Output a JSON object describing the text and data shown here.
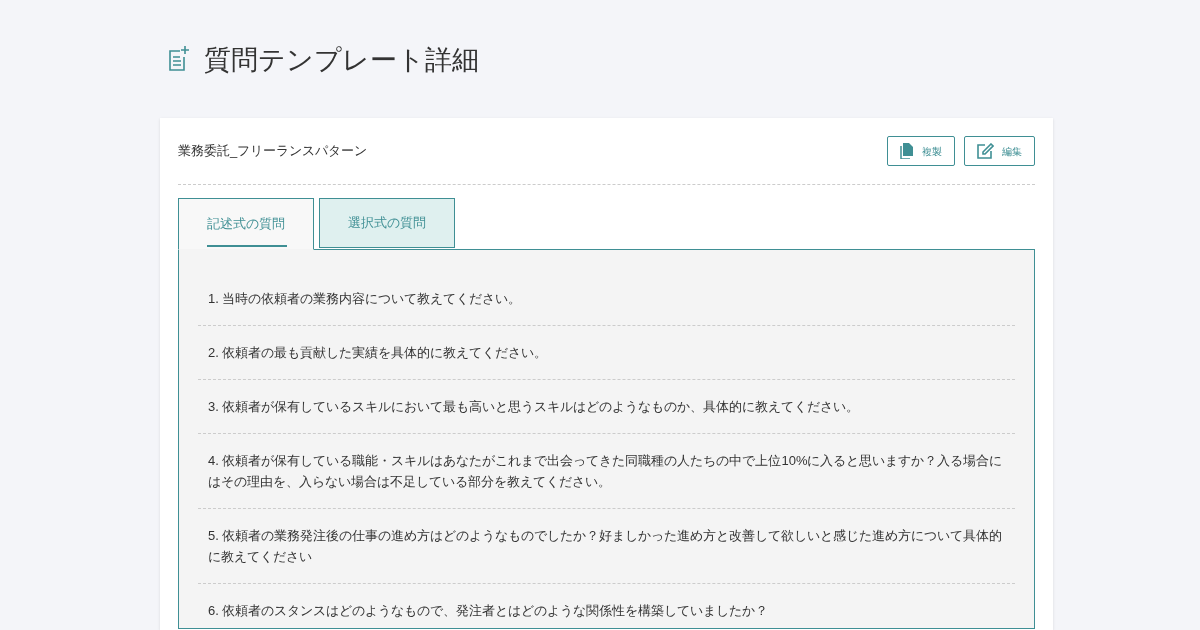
{
  "page_title": "質問テンプレート詳細",
  "card": {
    "title": "業務委託_フリーランスパターン",
    "buttons": [
      {
        "kind": "copy",
        "label": "複製"
      },
      {
        "kind": "edit",
        "label": "編集"
      }
    ]
  },
  "tabs": [
    {
      "label": "記述式の質問",
      "selected": true
    },
    {
      "label": "選択式の質問",
      "selected": false
    }
  ],
  "questions": [
    "1. 当時の依頼者の業務内容について教えてください。",
    "2. 依頼者の最も貢献した実績を具体的に教えてください。",
    "3. 依頼者が保有しているスキルにおいて最も高いと思うスキルはどのようなものか、具体的に教えてください。",
    "4. 依頼者が保有している職能・スキルはあなたがこれまで出会ってきた同職種の人たちの中で上位10%に入ると思いますか？入る場合にはその理由を、入らない場合は不足している部分を教えてください。",
    "5. 依頼者の業務発注後の仕事の進め方はどのようなものでしたか？好ましかった進め方と改善して欲しいと感じた進め方について具体的に教えてください",
    "6. 依頼者のスタンスはどのようなもので、発注者とはどのような関係性を構築していましたか？"
  ]
}
